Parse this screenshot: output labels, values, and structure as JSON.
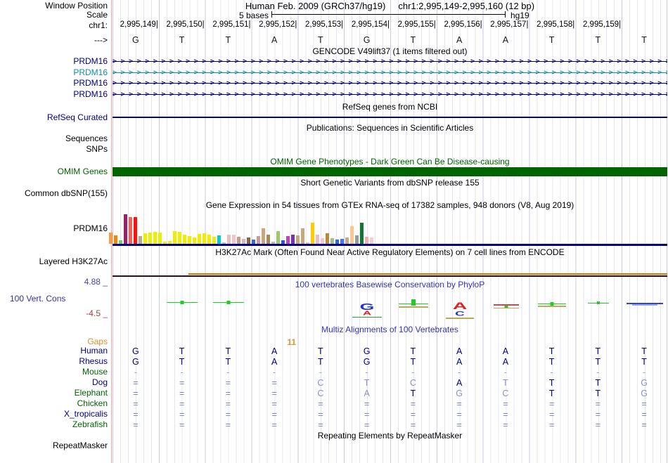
{
  "header": {
    "window_position_label": "Window Position",
    "assembly_title": "Human Feb. 2009 (GRCh37/hg19)",
    "position_title": "chr1:2,995,149-2,995,160 (12 bp)",
    "scale_label": "Scale",
    "scale_value": "5 bases",
    "assembly_short": "hg19",
    "chrom_label": "chr1:",
    "strand_label": "--->"
  },
  "ruler": {
    "coords": [
      "2,995,149",
      "2,995,150",
      "2,995,151",
      "2,995,152",
      "2,995,153",
      "2,995,154",
      "2,995,155",
      "2,995,156",
      "2,995,157",
      "2,995,158",
      "2,995,159"
    ],
    "bases": [
      "G",
      "T",
      "T",
      "A",
      "T",
      "G",
      "T",
      "A",
      "A",
      "T",
      "T",
      "T"
    ]
  },
  "gencode": {
    "title": "GENCODE V49lift37 (1 items filtered out)",
    "genes": [
      {
        "label": "PRDM16",
        "color": "#000080"
      },
      {
        "label": "PRDM16",
        "color": "#0e8fa8"
      },
      {
        "label": "PRDM16",
        "color": "#000080"
      },
      {
        "label": "PRDM16",
        "color": "#000080"
      }
    ]
  },
  "refseq": {
    "title": "RefSeq genes from NCBI",
    "label": "RefSeq Curated",
    "line_color": "#000060"
  },
  "publications": {
    "title": "Publications: Sequences in Scientific Articles",
    "sequences_label": "Sequences",
    "snps_label": "SNPs"
  },
  "omim": {
    "title": "OMIM Gene Phenotypes - Dark Green Can Be Disease-causing",
    "label": "OMIM Genes",
    "bar_color": "#006400"
  },
  "dbsnp": {
    "title": "Short Genetic Variants from dbSNP release 155",
    "label": "Common dbSNP(155)"
  },
  "gtex": {
    "title": "Gene Expression in 54 tissues from GTEx RNA-seq of 17382 samples, 948 donors (V8, Aug 2019)",
    "label": "PRDM16"
  },
  "chart_data": {
    "type": "bar",
    "title": "Gene Expression in 54 tissues from GTEx RNA-seq of 17382 samples, 948 donors (V8, Aug 2019)",
    "note": "54 GTEx tissue expression bars; tissue names not visible in screenshot; heights in track pixels (max 46)",
    "bars": [
      [
        "#FF9944",
        16
      ],
      [
        "#EE8800",
        12
      ],
      [
        "#77CC77",
        5
      ],
      [
        "#992266",
        42
      ],
      [
        "#EE6655",
        38
      ],
      [
        "#FF1111",
        38
      ],
      [
        "#BBAA88",
        11
      ],
      [
        "#EEEE00",
        15
      ],
      [
        "#EEEE00",
        16
      ],
      [
        "#EEEE00",
        17
      ],
      [
        "#EEEE00",
        16
      ],
      [
        "#EEEE00",
        3
      ],
      [
        "#EEEE00",
        4
      ],
      [
        "#EEEE00",
        18
      ],
      [
        "#EEEE00",
        17
      ],
      [
        "#EEEE00",
        13
      ],
      [
        "#EEEE00",
        11
      ],
      [
        "#EEEE00",
        9
      ],
      [
        "#EEEE00",
        14
      ],
      [
        "#EEEE00",
        15
      ],
      [
        "#EEEE00",
        13
      ],
      [
        "#EEEE00",
        10
      ],
      [
        "#00CCCC",
        12
      ],
      [
        "#AACCCC",
        2
      ],
      [
        "#E8C0C0",
        13
      ],
      [
        "#EEC8C8",
        13
      ],
      [
        "#CC9988",
        10
      ],
      [
        "#D8B8B8",
        7
      ],
      [
        "#886644",
        9
      ],
      [
        "#4466CC",
        6
      ],
      [
        "#CC9999",
        11
      ],
      [
        "#C8A878",
        22
      ],
      [
        "#A88858",
        13
      ],
      [
        "#C8B898",
        3
      ],
      [
        "#99CC66",
        18
      ],
      [
        "#3355CC",
        5
      ],
      [
        "#BB44BB",
        11
      ],
      [
        "#7733AA",
        13
      ],
      [
        "#C8A878",
        12
      ],
      [
        "#C8A878",
        22
      ],
      [
        "#D8C8B8",
        2
      ],
      [
        "#FFCC00",
        30
      ],
      [
        "#F0B8C8",
        13
      ],
      [
        "#F8C8C8",
        8
      ],
      [
        "#BB8833",
        15
      ],
      [
        "#AABB99",
        8
      ],
      [
        "#3366DD",
        6
      ],
      [
        "#4477EE",
        7
      ],
      [
        "#C8A888",
        9
      ],
      [
        "#F8C890",
        25
      ],
      [
        "#999999",
        12
      ],
      [
        "#117733",
        30
      ],
      [
        "#F0B0B0",
        10
      ],
      [
        "#F5CFCF",
        9
      ]
    ]
  },
  "h3k27ac": {
    "title": "H3K27Ac Mark (Often Found Near Active Regulatory Elements) on 7 cell lines from ENCODE",
    "label": "Layered H3K27Ac",
    "line_orange": "#cc7700",
    "line_dark": "#2e0e1e"
  },
  "conservation": {
    "title": "100 vertebrates Basewise Conservation by PhyloP",
    "label": "100 Vert. Cons",
    "max_label": "4.88 _",
    "min_label": "-4.5 _",
    "glyphs": [
      {
        "col": 1,
        "items": [
          [
            "box",
            "#22CC22",
            5,
            5,
            4
          ],
          [
            "line",
            "#22CC22",
            44,
            1,
            6
          ]
        ]
      },
      {
        "col": 2,
        "items": [
          [
            "box",
            "#22CC22",
            5,
            5,
            4
          ],
          [
            "line",
            "#22CC22",
            44,
            1,
            6
          ]
        ]
      },
      {
        "col": 5,
        "items": [
          [
            "letter",
            "G",
            "#2233CC",
            14,
            6
          ],
          [
            "letter",
            "A",
            "#DD2222",
            9,
            18
          ],
          [
            "line",
            "#22AA22",
            42,
            1,
            27
          ]
        ]
      },
      {
        "col": 6,
        "items": [
          [
            "line",
            "#22CC22",
            42,
            1,
            8
          ],
          [
            "box",
            "#22CC22",
            6,
            9,
            2
          ],
          [
            "line",
            "#BBAA55",
            42,
            2,
            12
          ]
        ]
      },
      {
        "col": 7,
        "items": [
          [
            "letter",
            "A",
            "#DD2222",
            15,
            5
          ],
          [
            "letter",
            "C",
            "#2233CC",
            10,
            19
          ],
          [
            "line",
            "#BBAA55",
            40,
            2,
            28
          ]
        ]
      },
      {
        "col": 8,
        "items": [
          [
            "line",
            "#DD4444",
            36,
            2,
            9
          ],
          [
            "box",
            "#22CC22",
            5,
            4,
            11
          ],
          [
            "line",
            "#BBAA55",
            36,
            1,
            14
          ]
        ]
      },
      {
        "col": 9,
        "items": [
          [
            "box",
            "#22CC22",
            5,
            5,
            6
          ],
          [
            "line",
            "#22CC22",
            40,
            1,
            8
          ],
          [
            "line",
            "#BBAA55",
            40,
            2,
            11
          ]
        ]
      },
      {
        "col": 10,
        "items": [
          [
            "box",
            "#22CC22",
            4,
            4,
            5
          ],
          [
            "line",
            "#22CC22",
            30,
            1,
            7
          ]
        ]
      },
      {
        "col": 11,
        "items": [
          [
            "line",
            "#3344CC",
            52,
            2,
            7
          ],
          [
            "line",
            "#99AAEE",
            36,
            2,
            9
          ]
        ]
      }
    ]
  },
  "multiz": {
    "title": "Multiz Alignments of 100 Vertebrates",
    "gaps": {
      "label": "Gaps",
      "value": "11",
      "column": 4
    },
    "rows": [
      {
        "label": "Human",
        "label_color": "#000080",
        "cells": [
          [
            "G",
            "d"
          ],
          [
            "T",
            "d"
          ],
          [
            "T",
            "d"
          ],
          [
            "A",
            "d"
          ],
          [
            "T",
            "d"
          ],
          [
            "G",
            "d"
          ],
          [
            "T",
            "d"
          ],
          [
            "A",
            "d"
          ],
          [
            "A",
            "d"
          ],
          [
            "T",
            "d"
          ],
          [
            "T",
            "d"
          ],
          [
            "T",
            "d"
          ]
        ]
      },
      {
        "label": "Rhesus",
        "label_color": "#000080",
        "cells": [
          [
            "G",
            "d"
          ],
          [
            "T",
            "d"
          ],
          [
            "T",
            "d"
          ],
          [
            "A",
            "d"
          ],
          [
            "T",
            "d"
          ],
          [
            "G",
            "d"
          ],
          [
            "T",
            "d"
          ],
          [
            "A",
            "d"
          ],
          [
            "A",
            "d"
          ],
          [
            "T",
            "d"
          ],
          [
            "T",
            "d"
          ],
          [
            "T",
            "d"
          ]
        ]
      },
      {
        "label": "Mouse",
        "label_color": "#006400",
        "cells": [
          [
            "-",
            "h"
          ],
          [
            "-",
            "h"
          ],
          [
            "-",
            "h"
          ],
          [
            "-",
            "h"
          ],
          [
            "-",
            "h"
          ],
          [
            "-",
            "h"
          ],
          [
            "-",
            "h"
          ],
          [
            "-",
            "h"
          ],
          [
            "-",
            "h"
          ],
          [
            "-",
            "h"
          ],
          [
            "-",
            "h"
          ],
          [
            "-",
            "h"
          ]
        ]
      },
      {
        "label": "Dog",
        "label_color": "#000080",
        "cells": [
          [
            "=",
            "e"
          ],
          [
            "=",
            "e"
          ],
          [
            "=",
            "e"
          ],
          [
            "=",
            "e"
          ],
          [
            "C",
            "l"
          ],
          [
            "T",
            "l"
          ],
          [
            "C",
            "l"
          ],
          [
            "A",
            "d"
          ],
          [
            "T",
            "l"
          ],
          [
            "T",
            "d"
          ],
          [
            "T",
            "d"
          ],
          [
            "G",
            "l"
          ]
        ]
      },
      {
        "label": "Elephant",
        "label_color": "#006400",
        "cells": [
          [
            "=",
            "e"
          ],
          [
            "=",
            "e"
          ],
          [
            "=",
            "e"
          ],
          [
            "=",
            "e"
          ],
          [
            "C",
            "l"
          ],
          [
            "A",
            "l"
          ],
          [
            "T",
            "d"
          ],
          [
            "G",
            "l"
          ],
          [
            "C",
            "l"
          ],
          [
            "T",
            "d"
          ],
          [
            "T",
            "d"
          ],
          [
            "G",
            "l"
          ]
        ]
      },
      {
        "label": "Chicken",
        "label_color": "#006400",
        "cells": [
          [
            "=",
            "e"
          ],
          [
            "=",
            "e"
          ],
          [
            "=",
            "e"
          ],
          [
            "=",
            "e"
          ],
          [
            "=",
            "e"
          ],
          [
            "=",
            "e"
          ],
          [
            "=",
            "e"
          ],
          [
            "=",
            "e"
          ],
          [
            "=",
            "e"
          ],
          [
            "=",
            "e"
          ],
          [
            "=",
            "e"
          ],
          [
            "=",
            "e"
          ]
        ]
      },
      {
        "label": "X_tropicalis",
        "label_color": "#000080",
        "cells": [
          [
            "=",
            "e"
          ],
          [
            "=",
            "e"
          ],
          [
            "=",
            "e"
          ],
          [
            "=",
            "e"
          ],
          [
            "=",
            "e"
          ],
          [
            "=",
            "e"
          ],
          [
            "=",
            "e"
          ],
          [
            "=",
            "e"
          ],
          [
            "=",
            "e"
          ],
          [
            "=",
            "e"
          ],
          [
            "=",
            "e"
          ],
          [
            "=",
            "e"
          ]
        ]
      },
      {
        "label": "Zebrafish",
        "label_color": "#006400",
        "cells": [
          [
            "=",
            "e"
          ],
          [
            "=",
            "e"
          ],
          [
            "=",
            "e"
          ],
          [
            "=",
            "e"
          ],
          [
            "=",
            "e"
          ],
          [
            "=",
            "e"
          ],
          [
            "=",
            "e"
          ],
          [
            "=",
            "e"
          ],
          [
            "=",
            "e"
          ],
          [
            "=",
            "e"
          ],
          [
            "=",
            "e"
          ],
          [
            "=",
            "e"
          ]
        ]
      }
    ]
  },
  "repeatmasker": {
    "title": "Repeating Elements by RepeatMasker",
    "label": "RepeatMasker"
  },
  "colors": {
    "grid": "#e4e4f4",
    "grid_major": "#c9c9e2",
    "edge_pink": "#f4a8a8",
    "navy": "#000080",
    "green": "#006400",
    "gaps_orange": "#e0972f",
    "cons_title_blue": "#3333bb",
    "cons_max_blue": "#4444aa",
    "cons_min_maroon": "#994444",
    "match_letter": "#000080",
    "mismatch_letter": "#8890c8",
    "equals_glyph": "#7880c0",
    "dash_glyph": "#98a0d0",
    "gtex_baseline": "#000080",
    "refseq_line": "#000060",
    "omim_bar": "#006400"
  }
}
